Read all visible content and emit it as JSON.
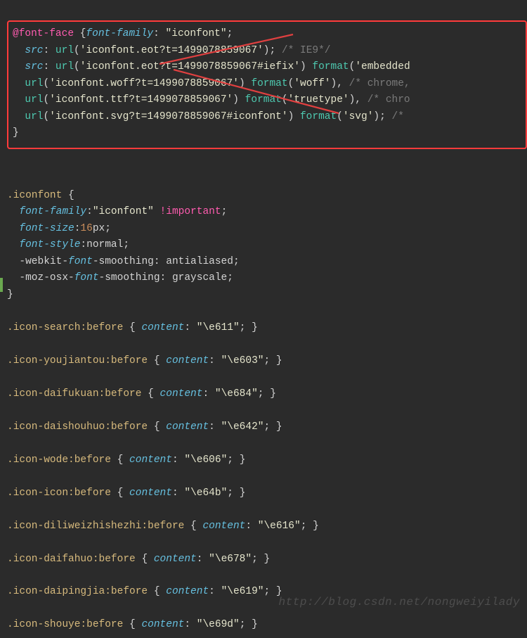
{
  "fontface": {
    "at": "@font-face",
    "open": " {",
    "close": "}",
    "l1a": "font-family",
    "l1b": ": ",
    "l1c": "\"iconfont\"",
    "l1d": ";",
    "l2a": "  src",
    "l2b": ": ",
    "l2c": "url",
    "l2d": "(",
    "l2e": "'iconfont.eot?t=1499078859067'",
    "l2f": "); ",
    "l2g": "/* IE9*/",
    "l3a": "  src",
    "l3b": ": ",
    "l3c": "url",
    "l3d": "(",
    "l3e": "'iconfont.eot?t=1499078859067#iefix'",
    "l3f": ") ",
    "l3g": "format",
    "l3h": "(",
    "l3i": "'embedded",
    "l4a": "  url",
    "l4b": "(",
    "l4c": "'iconfont.woff?t=1499078859067'",
    "l4d": ") ",
    "l4e": "format",
    "l4f": "(",
    "l4g": "'woff'",
    "l4h": "), ",
    "l4i": "/* chrome,",
    "l5a": "  url",
    "l5b": "(",
    "l5c": "'iconfont.ttf?t=1499078859067'",
    "l5d": ") ",
    "l5e": "format",
    "l5f": "(",
    "l5g": "'truetype'",
    "l5h": "), ",
    "l5i": "/* chro",
    "l6a": "  url",
    "l6b": "(",
    "l6c": "'iconfont.svg?t=1499078859067#iconfont'",
    "l6d": ") ",
    "l6e": "format",
    "l6f": "(",
    "l6g": "'svg'",
    "l6h": "); ",
    "l6i": "/*"
  },
  "iconfont": {
    "sel": ".iconfont",
    "open": " {",
    "close": "}",
    "p1a": "  font-family",
    "p1b": ":",
    "p1c": "\"iconfont\"",
    "p1d": " ",
    "p1e": "!important",
    "p1f": ";",
    "p2a": "  font-size",
    "p2b": ":",
    "p2c": "16",
    "p2d": "px",
    "p2e": ";",
    "p3a": "  font-style",
    "p3b": ":normal;",
    "p4a": "  -webkit-",
    "p4b": "font",
    "p4c": "-smoothing: antialiased;",
    "p5a": "  -moz-osx-",
    "p5b": "font",
    "p5c": "-smoothing: grayscale;"
  },
  "rules": {
    "propname": "content",
    "sels": {
      "r0": ".icon-search:before",
      "r1": ".icon-youjiantou:before",
      "r2": ".icon-daifukuan:before",
      "r3": ".icon-daishouhuo:before",
      "r4": ".icon-wode:before",
      "r5": ".icon-icon:before",
      "r6": ".icon-diliweizhishezhi:before",
      "r7": ".icon-daifahuo:before",
      "r8": ".icon-daipingjia:before",
      "r9": ".icon-shouye:before"
    },
    "vals": {
      "r0": "\"\\e611\"",
      "r1": "\"\\e603\"",
      "r2": "\"\\e684\"",
      "r3": "\"\\e642\"",
      "r4": "\"\\e606\"",
      "r5": "\"\\e64b\"",
      "r6": "\"\\e616\"",
      "r7": "\"\\e678\"",
      "r8": "\"\\e619\"",
      "r9": "\"\\e69d\""
    }
  },
  "watermark": "http://blog.csdn.net/nongweiyilady"
}
